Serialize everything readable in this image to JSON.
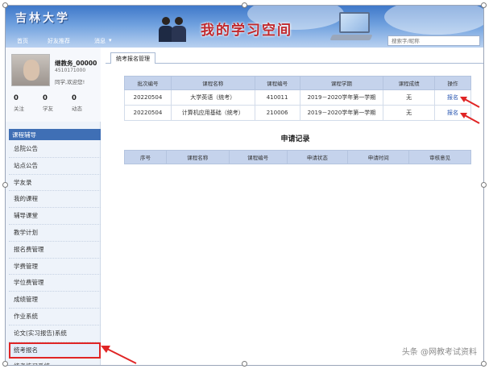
{
  "header": {
    "logo": "吉林大学",
    "slogan": "我的学习空间",
    "nav": [
      "首页",
      "好友推荐",
      "消息"
    ],
    "search_placeholder": "搜索字/昵称"
  },
  "profile": {
    "name": "继教务_00000",
    "id": "4510171000",
    "welcome": "同学,欢迎您!",
    "stats": [
      {
        "num": "0",
        "label": "关注"
      },
      {
        "num": "0",
        "label": "学友"
      },
      {
        "num": "0",
        "label": "动态"
      }
    ]
  },
  "sidebar": {
    "header": "课程辅导",
    "items": [
      "总院公告",
      "站点公告",
      "学友录",
      "我的课程",
      "辅导课堂",
      "教学计划",
      "报名费管理",
      "学费管理",
      "学位费管理",
      "成绩管理",
      "作业系统",
      "论文(实习报告)系统",
      "统考报名",
      "统考练习系统"
    ]
  },
  "main": {
    "tab": "统考报名管理",
    "table1": {
      "headers": [
        "批次编号",
        "课程名称",
        "课程编号",
        "课程学期",
        "课程成绩",
        "操作"
      ],
      "rows": [
        [
          "20220504",
          "大学英语（统考）",
          "410011",
          "2019－2020学年第一学期",
          "无",
          "报名"
        ],
        [
          "20220504",
          "计算机应用基础（统考）",
          "210006",
          "2019－2020学年第一学期",
          "无",
          "报名"
        ]
      ]
    },
    "section_title": "申请记录",
    "table2": {
      "headers": [
        "序号",
        "课程名称",
        "课程编号",
        "申请状态",
        "申请时间",
        "审核意见"
      ]
    }
  },
  "watermark": "头条 @网教考试资料",
  "colors": {
    "banner": "#3f78c9",
    "menu_head": "#3f6fb5",
    "table_head": "#c5d3ec",
    "arrow": "#e02525"
  }
}
